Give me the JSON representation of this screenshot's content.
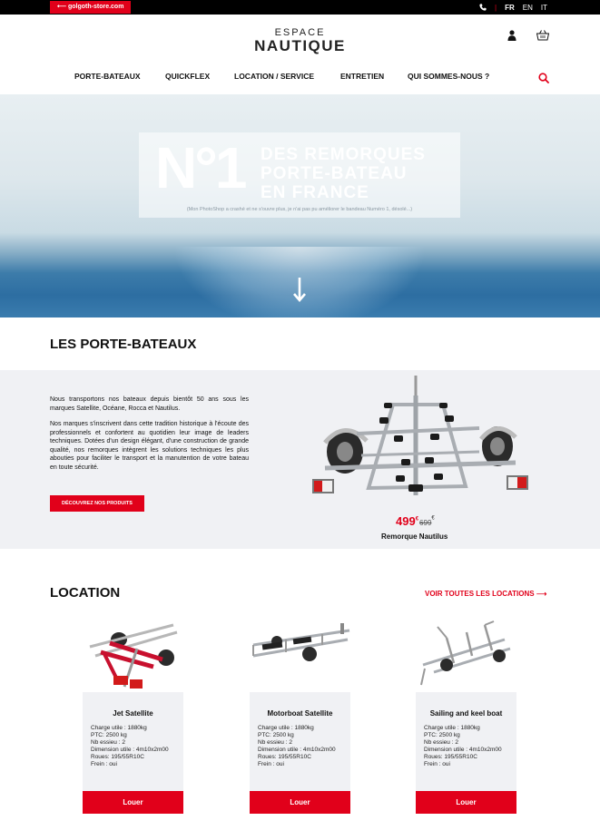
{
  "topbar": {
    "store_link": "⟵ golgoth-store.com",
    "phone_icon": "phone-icon",
    "languages": [
      "FR",
      "EN",
      "IT"
    ],
    "active_language": "FR"
  },
  "header": {
    "logo_top": "ESPACE",
    "logo_main": "NAUTIQUE",
    "icons": [
      "user-icon",
      "cart-icon"
    ]
  },
  "nav": {
    "items": [
      "PORTE-BATEAUX",
      "QUICKFLEX",
      "LOCATION / SERVICE",
      "ENTRETIEN",
      "QUI SOMMES-NOUS ?"
    ],
    "search_icon": "search-icon"
  },
  "hero": {
    "banner_no": "N°1",
    "banner_lines": [
      "DES REMORQUES",
      "PORTE-BATEAU",
      "EN FRANCE"
    ],
    "banner_note": "(Mon PhotoShop a crashé et ne s'ouvre plus, je n'ai pas pu améliorer le bandeau Numéro 1, désolé...)",
    "scroll_icon": "arrow-down-icon"
  },
  "porte_bateaux": {
    "title": "LES PORTE-BATEAUX",
    "paragraph1": "Nous transportons nos bateaux depuis bientôt 50 ans sous les marques Satellite, Océane, Rocca et Nautilus.",
    "paragraph2": "Nos marques s'inscrivent dans cette tradition historique à l'écoute des professionnels et confortent au quotidien leur image de leaders techniques. Dotées d'un design élégant, d'une construction de grande qualité, nos remorques intègrent les solutions techniques les plus abouties pour faciliter le transport et la manutention de votre bateau en toute sécurité.",
    "button": "DÉCOUVREZ NOS PRODUITS",
    "product": {
      "price_new": "499",
      "price_old": "699",
      "currency": "€",
      "name": "Remorque Nautilus"
    }
  },
  "location": {
    "title": "LOCATION",
    "see_all": "VOIR TOUTES LES LOCATIONS ⟶",
    "cards": [
      {
        "title": "Jet Satellite",
        "specs": [
          "Charge utile : 1880kg",
          "PTC: 2500 kg",
          "Nb essieu : 2",
          "Dimension utile : 4m10x2m00",
          "Roues: 195/55R10C",
          "Frein : oui"
        ],
        "button": "Louer"
      },
      {
        "title": "Motorboat Satellite",
        "specs": [
          "Charge utile : 1880kg",
          "PTC: 2500 kg",
          "Nb essieu : 2",
          "Dimension utile : 4m10x2m00",
          "Roues: 195/55R10C",
          "Frein : oui"
        ],
        "button": "Louer"
      },
      {
        "title": "Sailing and keel boat",
        "specs": [
          "Charge utile : 1880kg",
          "PTC: 2500 kg",
          "Nb essieu : 2",
          "Dimension utile : 4m10x2m00",
          "Roues: 195/55R10C",
          "Frein : oui"
        ],
        "button": "Louer"
      }
    ]
  },
  "colors": {
    "accent": "#e1001a",
    "topbar": "#000000",
    "band": "#f0f1f4"
  }
}
